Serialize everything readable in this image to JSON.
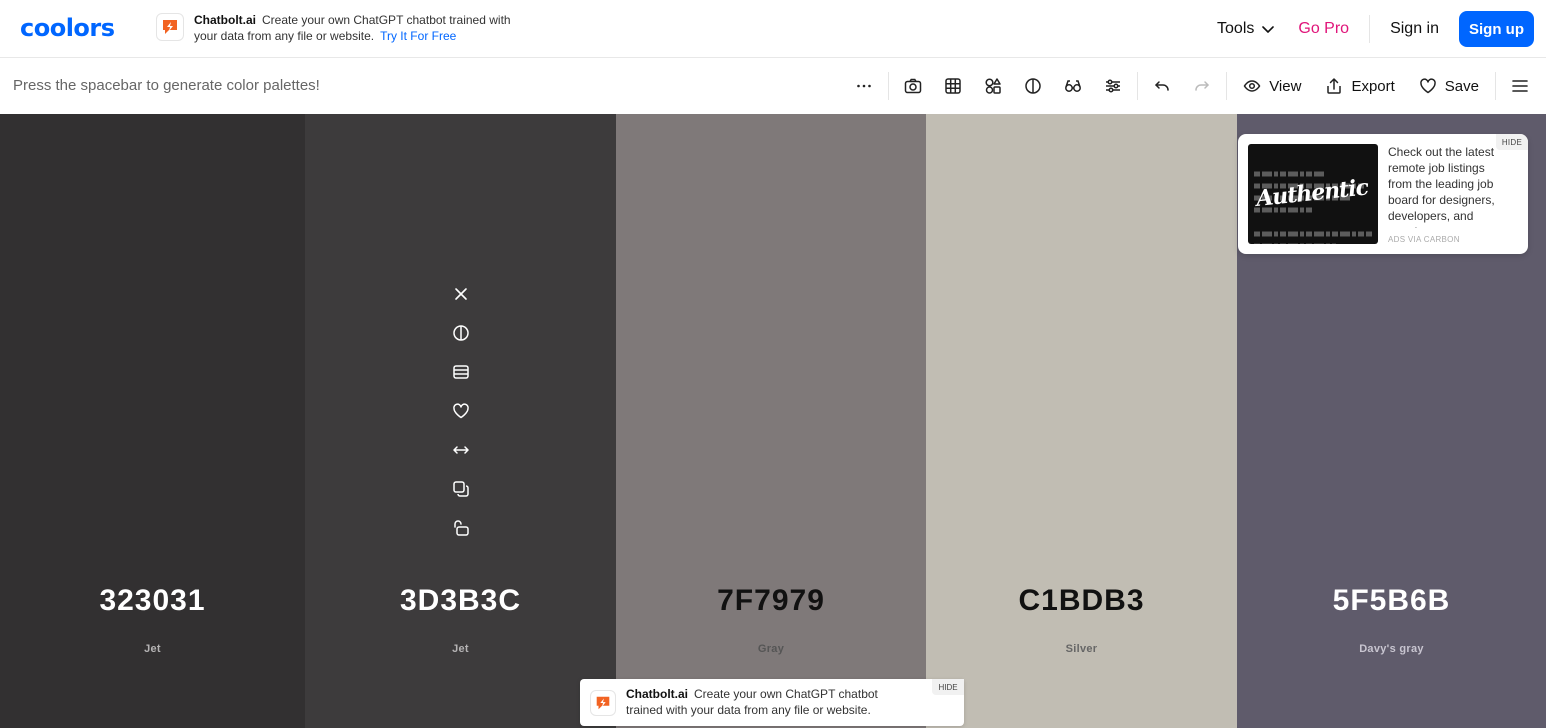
{
  "brand": {
    "logo": "coolors",
    "accent": "#0066ff"
  },
  "top_ad": {
    "name": "Chatbolt.ai",
    "text": "Create your own ChatGPT chatbot trained with your data from any file or website.",
    "link": "Try It For Free"
  },
  "nav": {
    "tools": "Tools",
    "go_pro": "Go Pro",
    "sign_in": "Sign in",
    "sign_up": "Sign up"
  },
  "toolbar": {
    "hint": "Press the spacebar to generate color palettes!",
    "icons": [
      "more-icon",
      "camera-icon",
      "grid-icon",
      "shapes-icon",
      "contrast-icon",
      "glasses-icon",
      "sliders-icon",
      "undo-icon",
      "redo-icon"
    ],
    "view": "View",
    "export": "Export",
    "save": "Save"
  },
  "palette": [
    {
      "hex": "323031",
      "name": "Jet",
      "color": "#323031"
    },
    {
      "hex": "3D3B3C",
      "name": "Jet",
      "color": "#3d3b3c"
    },
    {
      "hex": "7F7979",
      "name": "Gray",
      "color": "#7f7979"
    },
    {
      "hex": "C1BDB3",
      "name": "Silver",
      "color": "#c1bdb3"
    },
    {
      "hex": "5F5B6B",
      "name": "Davy's gray",
      "color": "#5f5b6b"
    }
  ],
  "swatch_tools": [
    "close-icon",
    "contrast-icon",
    "shades-icon",
    "heart-icon",
    "drag-icon",
    "copy-icon",
    "unlock-icon"
  ],
  "carbon_ad": {
    "text": "Check out the latest remote job listings from the leading job board for designers, developers, and creative pros.",
    "via": "ADS VIA CARBON",
    "hide": "HIDE",
    "image_word": "Authentic"
  },
  "bottom_ad": {
    "name": "Chatbolt.ai",
    "text": "Create your own ChatGPT chatbot trained with your data from any file or website.",
    "hide": "HIDE"
  }
}
